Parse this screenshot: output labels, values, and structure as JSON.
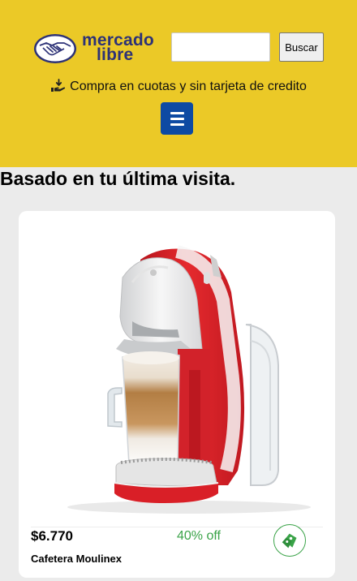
{
  "header": {
    "logo": {
      "line1": "mercado",
      "line2": "libre"
    },
    "search": {
      "value": "",
      "placeholder": "",
      "button_label": "Buscar"
    },
    "promo_text": "Compra en cuotas y sin tarjeta de credito",
    "menu_icon": "hamburger-icon"
  },
  "main": {
    "section_title": "Basado en tu última visita."
  },
  "product": {
    "image": "coffee-machine-image",
    "price": "$6.770",
    "discount": "40% off",
    "name": "Cafetera Moulinex",
    "cart_icon": "shopping-bag-icon"
  },
  "colors": {
    "header_bg": "#ebc927",
    "menu_button": "#0d4aa3",
    "discount": "#3aa348",
    "page_bg": "#ebebeb",
    "logo_text": "#2d3277"
  }
}
